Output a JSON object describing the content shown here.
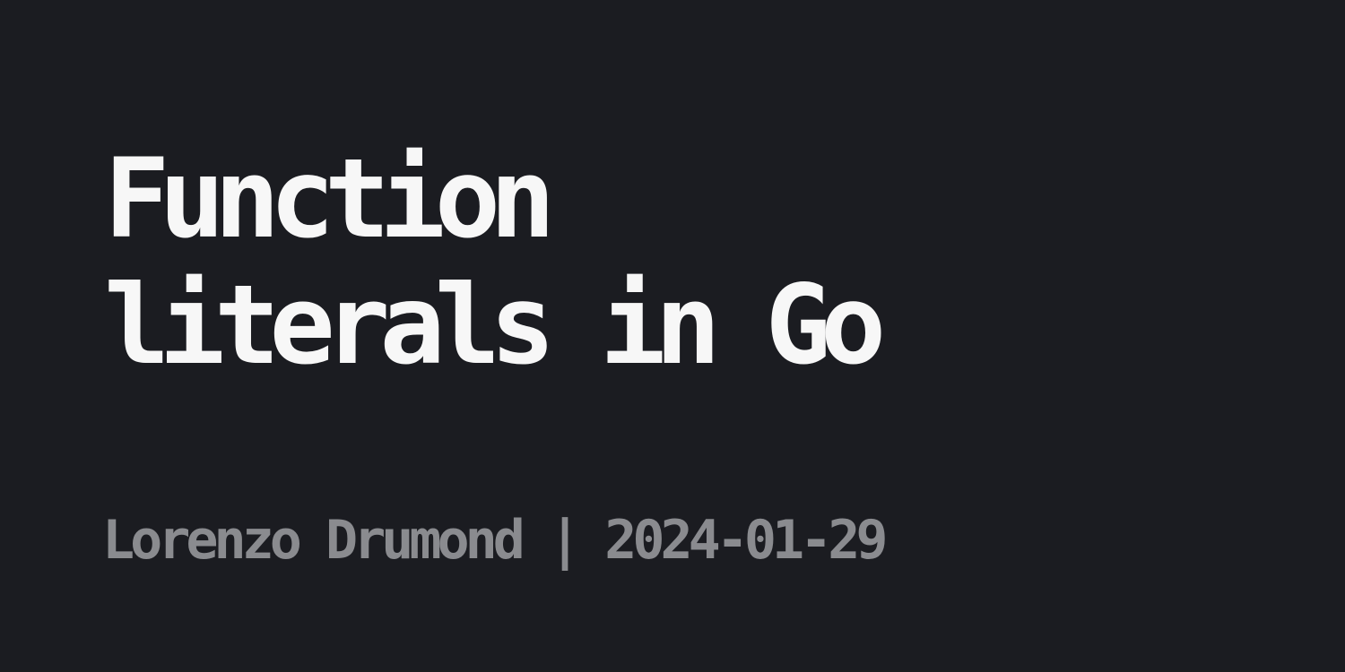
{
  "title": {
    "line1": "Function",
    "line2": "literals in Go"
  },
  "byline": {
    "author": "Lorenzo Drumond",
    "separator": "|",
    "date": "2024-01-29"
  },
  "colors": {
    "background": "#1b1c21",
    "title": "#f7f7f7",
    "byline": "#8a8b8f"
  }
}
